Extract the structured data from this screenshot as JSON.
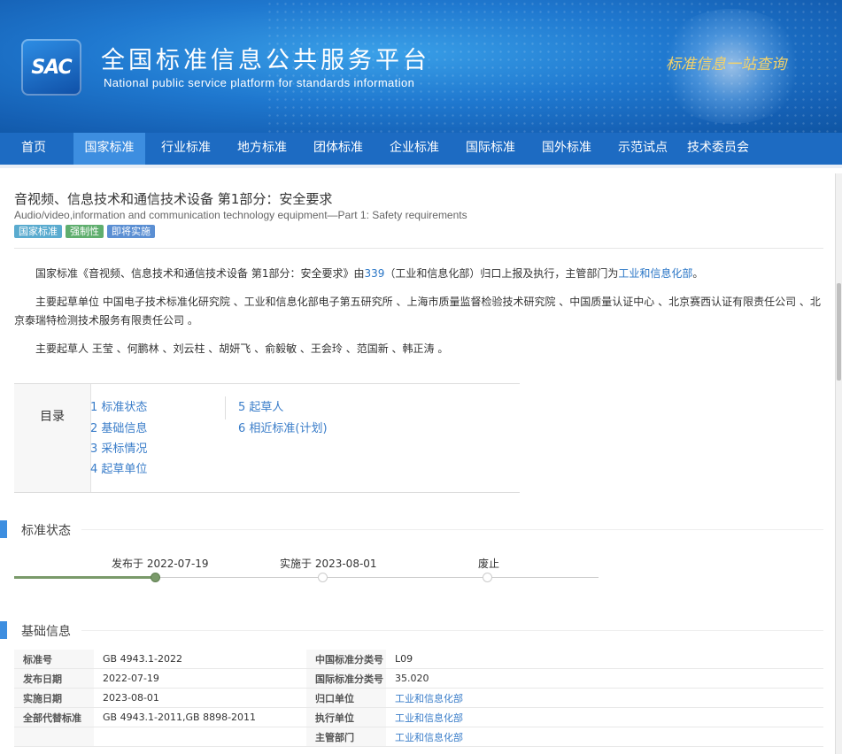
{
  "header": {
    "logo_text": "SAC",
    "title": "全国标准信息公共服务平台",
    "subtitle": "National public service platform  for standards information",
    "slogan": "标准信息一站查询"
  },
  "nav": {
    "items": [
      "首页",
      "国家标准",
      "行业标准",
      "地方标准",
      "团体标准",
      "企业标准",
      "国际标准",
      "国外标准",
      "示范试点",
      "技术委员会"
    ],
    "active_index": 1
  },
  "standard": {
    "title_cn": "音视频、信息技术和通信技术设备 第1部分：安全要求",
    "title_en": "Audio/video,information and communication technology equipment—Part 1: Safety requirements",
    "badges": [
      {
        "label": "国家标准",
        "color": "#5aabcf"
      },
      {
        "label": "强制性",
        "color": "#5fae6e"
      },
      {
        "label": "即将实施",
        "color": "#5b8fd3"
      }
    ]
  },
  "intro": {
    "p1_prefix": "国家标准《音视频、信息技术和通信技术设备 第1部分：安全要求》由",
    "p1_tc": "339",
    "p1_mid": "（工业和信息化部）归口上报及执行，主管部门为",
    "p1_dept": "工业和信息化部",
    "p1_end": "。",
    "p2": "主要起草单位 中国电子技术标准化研究院 、工业和信息化部电子第五研究所 、上海市质量监督检验技术研究院 、中国质量认证中心 、北京赛西认证有限责任公司 、北京泰瑞特检测技术服务有限责任公司 。",
    "p3": "主要起草人 王莹 、何鹏林 、刘云柱 、胡妍飞 、俞毅敏 、王会玲 、范国新 、韩正涛 。"
  },
  "toc": {
    "label": "目录",
    "items": [
      "1  标准状态",
      "2  基础信息",
      "3  采标情况",
      "4  起草单位",
      "5  起草人",
      "6  相近标准(计划)"
    ]
  },
  "status_section": {
    "heading": "标准状态",
    "steps": [
      {
        "label": "发布于 2022-07-19",
        "done": true
      },
      {
        "label": "实施于 2023-08-01",
        "done": false
      },
      {
        "label": "废止",
        "done": false
      }
    ]
  },
  "basic_section": {
    "heading": "基础信息",
    "rows": [
      {
        "k1": "标准号",
        "v1": "GB 4943.1-2022",
        "k2": "中国标准分类号",
        "v2": "L09",
        "v2_link": false
      },
      {
        "k1": "发布日期",
        "v1": "2022-07-19",
        "k2": "国际标准分类号",
        "v2": "35.020",
        "v2_link": false
      },
      {
        "k1": "实施日期",
        "v1": "2023-08-01",
        "k2": "归口单位",
        "v2": "工业和信息化部",
        "v2_link": true
      },
      {
        "k1": "全部代替标准",
        "v1": "GB 4943.1-2011,GB 8898-2011",
        "k2": "执行单位",
        "v2": "工业和信息化部",
        "v2_link": true
      },
      {
        "k1": "",
        "v1": "",
        "k2": "主管部门",
        "v2": "工业和信息化部",
        "v2_link": true
      }
    ]
  }
}
